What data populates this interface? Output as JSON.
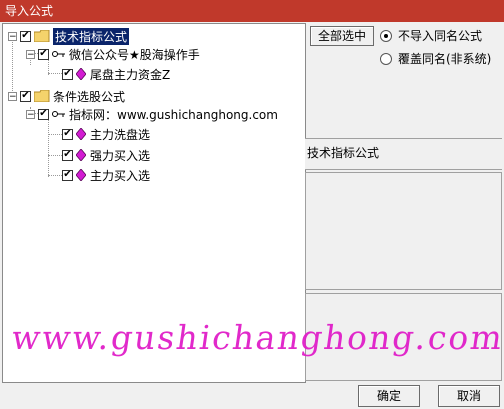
{
  "window": {
    "title": "导入公式"
  },
  "tree": {
    "nodes": [
      {
        "label": "技术指标公式"
      },
      {
        "label": "微信公众号★股海操作手"
      },
      {
        "label": "尾盘主力资金Z"
      },
      {
        "label": "条件选股公式"
      },
      {
        "label": "指标网：www.gushichanghong.com"
      },
      {
        "label": "主力洗盘选"
      },
      {
        "label": "强力买入选"
      },
      {
        "label": "主力买入选"
      }
    ]
  },
  "buttons": {
    "select_all": "全部选中",
    "ok": "确定",
    "cancel": "取消"
  },
  "radio": {
    "option1": "不导入同名公式",
    "option2": "覆盖同名(非系统)",
    "selected": "option1"
  },
  "info": {
    "category": "技术指标公式"
  },
  "watermark": "www.gushichanghong.com",
  "colors": {
    "titlebar": "#c0392b",
    "selection": "#0a246a",
    "watermark": "#e01ec8"
  }
}
